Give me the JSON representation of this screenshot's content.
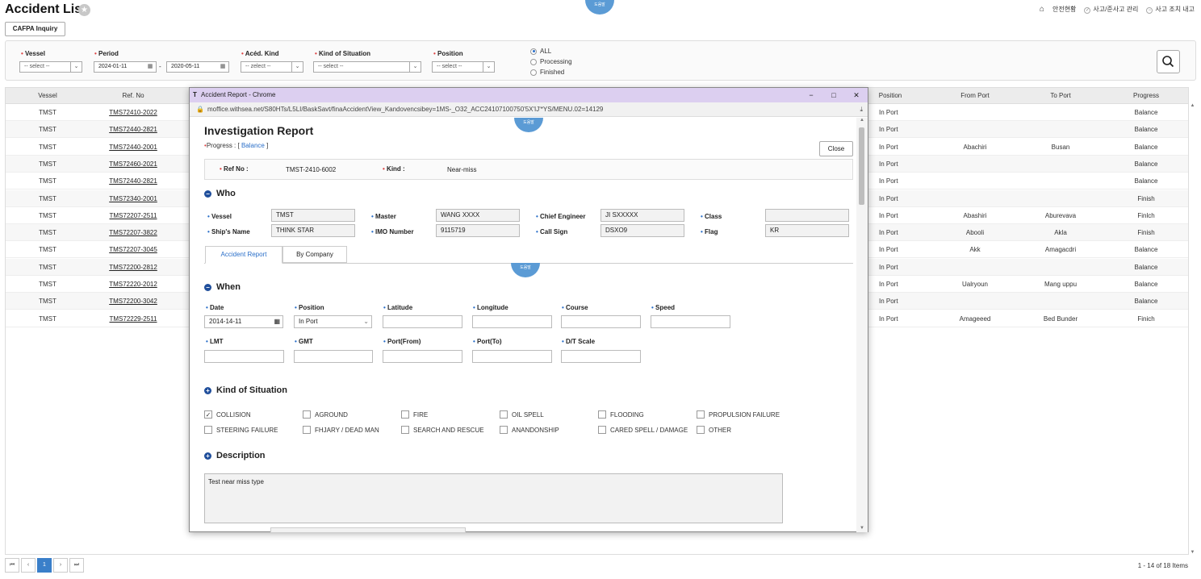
{
  "page": {
    "title": "Accident List",
    "bubble_label": "도움말"
  },
  "toplinks": [
    "안전현황",
    "사고/준사고 관리",
    "사고 조치 내고"
  ],
  "cafpa_label": "CAFPA Inquiry",
  "filter": {
    "vessel_label": "Vessel",
    "vessel_value": "-- select --",
    "period_label": "Period",
    "period_from": "2024-01-11",
    "period_sep": "-",
    "period_to": "2020-05-11",
    "kind_label": "Acéd. Kind",
    "kind_value": "-- zelect --",
    "situation_label": "Kind of Situation",
    "situation_value": "-- select --",
    "position_label": "Position",
    "position_value": "-- select --",
    "status_options": [
      "ALL",
      "Processing",
      "Finished"
    ],
    "status_selected": "ALL"
  },
  "grid": {
    "headers": [
      "Vessel",
      "Ref. No",
      "Position",
      "From Port",
      "To Port",
      "Progress"
    ],
    "rows": [
      {
        "vessel": "TMST",
        "ref": "TMS72410-2022",
        "position": "In Port",
        "from": "",
        "to": "",
        "progress": "Balance"
      },
      {
        "vessel": "TMST",
        "ref": "TMS72440-2821",
        "position": "In Port",
        "from": "",
        "to": "",
        "progress": "Balance"
      },
      {
        "vessel": "TMST",
        "ref": "TMS72440-2001",
        "position": "In Port",
        "from": "Abachiri",
        "to": "Busan",
        "progress": "Balance"
      },
      {
        "vessel": "TMST",
        "ref": "TMS72460-2021",
        "position": "In Port",
        "from": "",
        "to": "",
        "progress": "Balance"
      },
      {
        "vessel": "TMST",
        "ref": "TMS72440-2821",
        "position": "In Port",
        "from": "",
        "to": "",
        "progress": "Balance"
      },
      {
        "vessel": "TMST",
        "ref": "TMS72340-2001",
        "position": "In Port",
        "from": "",
        "to": "",
        "progress": "Finish"
      },
      {
        "vessel": "TMST",
        "ref": "TMS72207-2511",
        "position": "In Port",
        "from": "Abashiri",
        "to": "Aburevava",
        "progress": "Finlch"
      },
      {
        "vessel": "TMST",
        "ref": "TMS72207-3822",
        "position": "In Port",
        "from": "Abooli",
        "to": "Akla",
        "progress": "Finish"
      },
      {
        "vessel": "TMST",
        "ref": "TMS72207-3045",
        "position": "In Port",
        "from": "Akk",
        "to": "Amagacdri",
        "progress": "Balance"
      },
      {
        "vessel": "TMST",
        "ref": "TMS72200-2812",
        "position": "In Port",
        "from": "",
        "to": "",
        "progress": "Balance"
      },
      {
        "vessel": "TMST",
        "ref": "TMS72220-2012",
        "position": "In Port",
        "from": "Ualryoun",
        "to": "Mang uppu",
        "progress": "Balance"
      },
      {
        "vessel": "TMST",
        "ref": "TMS72200-3042",
        "position": "In Port",
        "from": "",
        "to": "",
        "progress": "Balance"
      },
      {
        "vessel": "TMST",
        "ref": "TMS72229-2511",
        "position": "In Port",
        "from": "Amageeed",
        "to": "Bed Bunder",
        "progress": "Finich"
      }
    ]
  },
  "pager": {
    "current": "1",
    "info": "1 - 14 of 18 Items"
  },
  "popup": {
    "window_title": "Accident Report - Chrome",
    "url": "moffice.withsea.net/S80HTs/L5LI/BaskSavt/finaAccidentView_Kandovencsibey=1MS-_O32_ACC24107100750'5X'IJ'*YS/MENU.02=14129",
    "heading": "Investigation Report",
    "progress_label": "Progress : [",
    "progress_value": "Balance",
    "progress_end": "]",
    "close_label": "Close",
    "refno_label": "Ref No :",
    "refno_value": "TMST-2410-6002",
    "kind_label": "Kind :",
    "kind_value": "Near-miss",
    "who": {
      "title": "Who",
      "vessel_label": "Vessel",
      "vessel": "TMST",
      "master_label": "Master",
      "master": "WANG XXXX",
      "chief_label": "Chief Engineer",
      "chief": "JI SXXXXX",
      "class_label": "Class",
      "class": "",
      "shipname_label": "Ship's Name",
      "shipname": "THINK STAR",
      "imo_label": "IMO Number",
      "imo": "9115719",
      "callsign_label": "Call Sign",
      "callsign": "DSXO9",
      "flag_label": "Flag",
      "flag": "KR"
    },
    "tabs": [
      "Accident Report",
      "By Company"
    ],
    "when": {
      "title": "When",
      "date_label": "Date",
      "date": "2014-14-11",
      "position_label": "Position",
      "position": "In Port",
      "lat_label": "Latitude",
      "lon_label": "Longitude",
      "course_label": "Course",
      "speed_label": "Speed",
      "lmt_label": "LMT",
      "gmt_label": "GMT",
      "from_label": "Port(From)",
      "to_label": "Port(To)",
      "dt_label": "D/T Scale"
    },
    "situation": {
      "title": "Kind of Situation",
      "items": [
        "COLLISION",
        "AGROUND",
        "FIRE",
        "OIL SPELL",
        "FLOODING",
        "PROPULSION FAILURE",
        "STEERING FAILURE",
        "FHJARY / DEAD MAN",
        "SEARCH AND RESCUE",
        "ANANDONSHIP",
        "CARED SPELL / DAMAGE",
        "OTHER"
      ],
      "checked": "COLLISION"
    },
    "description": {
      "title": "Description",
      "text": "Test near miss type"
    }
  },
  "colors": {
    "accent": "#2a6fc9",
    "section_icon": "#1f4e9b",
    "titlebar": "#dccff0",
    "bubble": "#5b9bd5"
  }
}
